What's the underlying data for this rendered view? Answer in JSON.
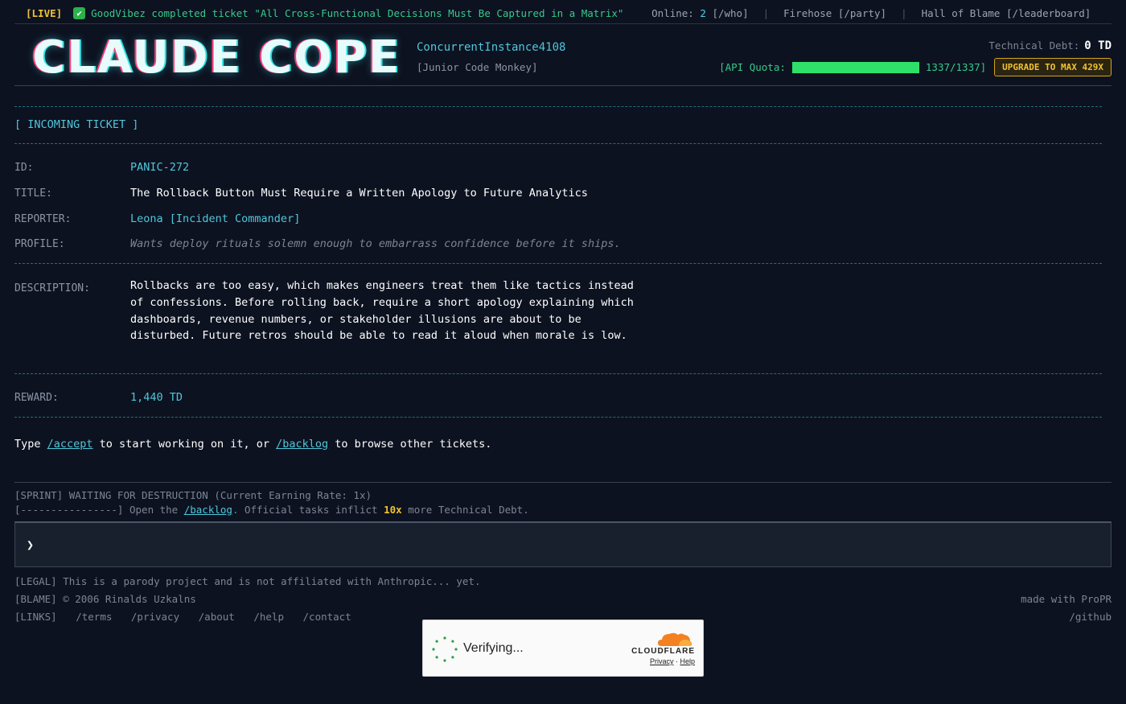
{
  "topbar": {
    "live": "[LIVE]",
    "check_icon": "✔",
    "ticker": "GoodVibez completed ticket \"All Cross-Functional Decisions Must Be Captured in a Matrix\"",
    "online_label": "Online:",
    "online_count": "2",
    "online_cmd": "[/who]",
    "sep": "|",
    "firehose": "Firehose [/party]",
    "hall": "Hall of Blame [/leaderboard]"
  },
  "header": {
    "logo": "CLAUDE COPE",
    "user_name": "ConcurrentInstance4108",
    "user_rank": "[Junior Code Monkey]",
    "debt_label": "Technical Debt:",
    "debt_value": "0 TD",
    "quota_label": "[API Quota:",
    "quota_value": "1337/1337]",
    "quota_fraction": 1.0,
    "upgrade_label": "UPGRADE TO MAX 429X"
  },
  "ticket": {
    "section_title": "[ INCOMING TICKET ]",
    "id_label": "ID:",
    "id": "PANIC-272",
    "title_label": "TITLE:",
    "title": "The Rollback Button Must Require a Written Apology to Future Analytics",
    "reporter_label": "REPORTER:",
    "reporter": "Leona [Incident Commander]",
    "profile_label": "PROFILE:",
    "profile": "Wants deploy rituals solemn enough to embarrass confidence before it ships.",
    "description_label": "DESCRIPTION:",
    "description": "Rollbacks are too easy, which makes engineers treat them like tactics instead of confessions. Before rolling back, require a short apology explaining which dashboards, revenue numbers, or stakeholder illusions are about to be disturbed. Future retros should be able to read it aloud when morale is low.",
    "reward_label": "REWARD:",
    "reward": "1,440 TD"
  },
  "prompt": {
    "pre": "Type ",
    "accept": "/accept",
    "mid": " to start working on it, or ",
    "backlog": "/backlog",
    "post": " to browse other tickets."
  },
  "sprint": {
    "line1": "[SPRINT] WAITING FOR DESTRUCTION (Current Earning Rate: 1x)",
    "bar": "[----------------]",
    "open": " Open the ",
    "backlog": "/backlog",
    "official": ". Official tasks inflict ",
    "multiplier": "10x",
    "tail": " more Technical Debt."
  },
  "input": {
    "prompt_icon": "❯"
  },
  "footer": {
    "legal": "[LEGAL] This is a parody project and is not affiliated with Anthropic... yet.",
    "blame": "[BLAME] © 2006 Rinalds Uzkalns",
    "links_label": "[LINKS]",
    "links": [
      "/terms",
      "/privacy",
      "/about",
      "/help",
      "/contact"
    ],
    "made_with": "made with ProPR",
    "github": "/github"
  },
  "captcha": {
    "status": "Verifying...",
    "brand": "CLOUDFLARE",
    "privacy": "Privacy",
    "dot": " · ",
    "help": "Help"
  },
  "colors": {
    "background": "#0d1220",
    "accent_cyan": "#4fc6db",
    "accent_green": "#37c98b",
    "accent_yellow": "#f1c232"
  }
}
